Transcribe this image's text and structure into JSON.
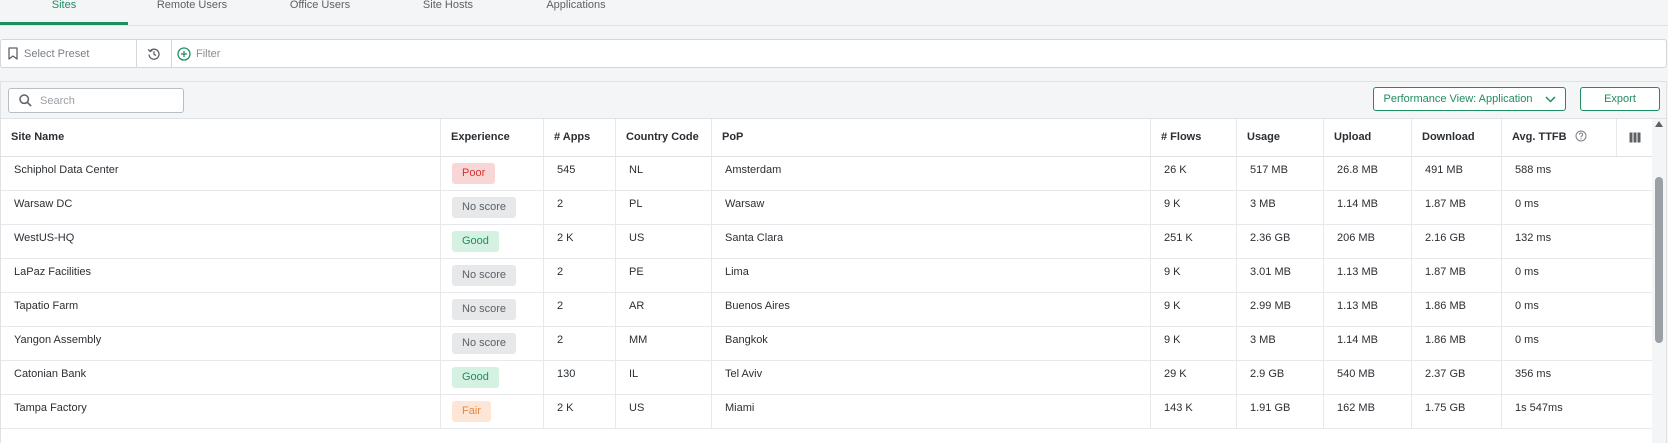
{
  "tabs": [
    {
      "label": "Sites",
      "active": true
    },
    {
      "label": "Remote Users",
      "active": false
    },
    {
      "label": "Office Users",
      "active": false
    },
    {
      "label": "Site Hosts",
      "active": false
    },
    {
      "label": "Applications",
      "active": false
    }
  ],
  "filterbar": {
    "preset_label": "Select Preset",
    "filter_label": "Filter"
  },
  "toolbar": {
    "search_placeholder": "Search",
    "performance_view_label": "Performance View: Application",
    "export_label": "Export"
  },
  "columns": [
    "Site Name",
    "Experience",
    "# Apps",
    "Country Code",
    "PoP",
    "# Flows",
    "Usage",
    "Upload",
    "Download",
    "Avg. TTFB"
  ],
  "rows": [
    {
      "site": "Schiphol Data Center",
      "experience": "Poor",
      "apps": "545",
      "country": "NL",
      "pop": "Amsterdam",
      "flows": "26 K",
      "usage": "517 MB",
      "upload": "26.8 MB",
      "download": "491 MB",
      "ttfb": "588 ms"
    },
    {
      "site": "Warsaw DC",
      "experience": "No score",
      "apps": "2",
      "country": "PL",
      "pop": "Warsaw",
      "flows": "9 K",
      "usage": "3 MB",
      "upload": "1.14 MB",
      "download": "1.87 MB",
      "ttfb": "0 ms"
    },
    {
      "site": "WestUS-HQ",
      "experience": "Good",
      "apps": "2 K",
      "country": "US",
      "pop": "Santa Clara",
      "flows": "251 K",
      "usage": "2.36 GB",
      "upload": "206 MB",
      "download": "2.16 GB",
      "ttfb": "132 ms"
    },
    {
      "site": "LaPaz Facilities",
      "experience": "No score",
      "apps": "2",
      "country": "PE",
      "pop": "Lima",
      "flows": "9 K",
      "usage": "3.01 MB",
      "upload": "1.13 MB",
      "download": "1.87 MB",
      "ttfb": "0 ms"
    },
    {
      "site": "Tapatio Farm",
      "experience": "No score",
      "apps": "2",
      "country": "AR",
      "pop": "Buenos Aires",
      "flows": "9 K",
      "usage": "2.99 MB",
      "upload": "1.13 MB",
      "download": "1.86 MB",
      "ttfb": "0 ms"
    },
    {
      "site": "Yangon Assembly",
      "experience": "No score",
      "apps": "2",
      "country": "MM",
      "pop": "Bangkok",
      "flows": "9 K",
      "usage": "3 MB",
      "upload": "1.14 MB",
      "download": "1.86 MB",
      "ttfb": "0 ms"
    },
    {
      "site": "Catonian Bank",
      "experience": "Good",
      "apps": "130",
      "country": "IL",
      "pop": "Tel Aviv",
      "flows": "29 K",
      "usage": "2.9 GB",
      "upload": "540 MB",
      "download": "2.37 GB",
      "ttfb": "356 ms"
    },
    {
      "site": "Tampa Factory",
      "experience": "Fair",
      "apps": "2 K",
      "country": "US",
      "pop": "Miami",
      "flows": "143 K",
      "usage": "1.91 GB",
      "upload": "162 MB",
      "download": "1.75 GB",
      "ttfb": "1s 547ms"
    }
  ],
  "colors": {
    "accent": "#1f8d62",
    "poor": "#d03434",
    "good": "#1f8d62",
    "fair": "#e08a47",
    "no_score": "#5d6166"
  }
}
